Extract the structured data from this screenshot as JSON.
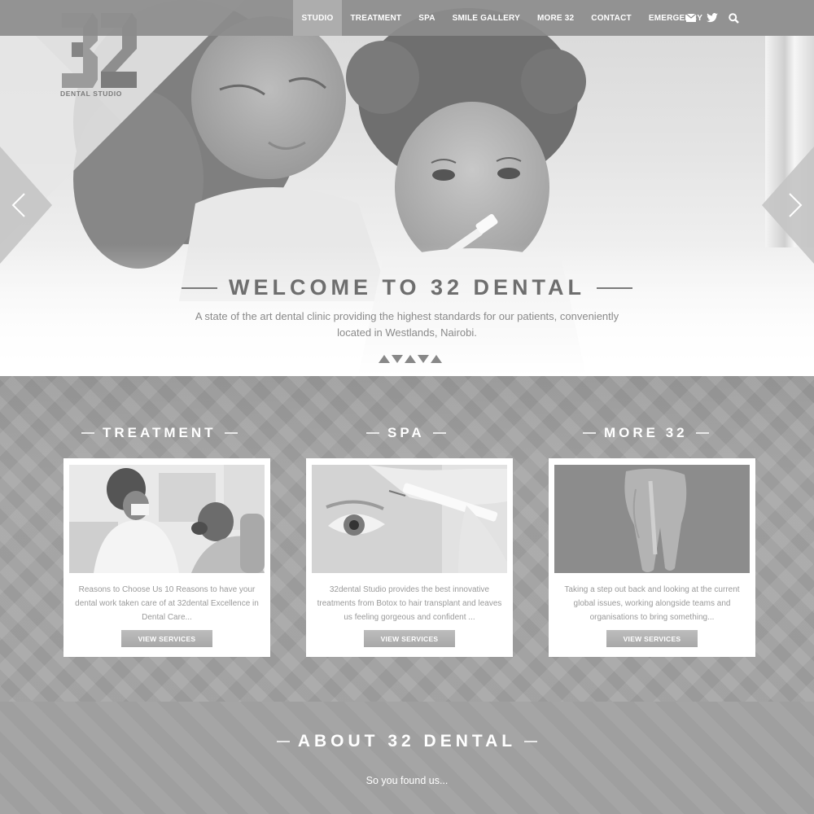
{
  "header": {
    "nav": [
      {
        "label": "STUDIO",
        "active": true
      },
      {
        "label": "TREATMENT",
        "active": false
      },
      {
        "label": "SPA",
        "active": false
      },
      {
        "label": "SMILE GALLERY",
        "active": false
      },
      {
        "label": "MORE 32",
        "active": false
      },
      {
        "label": "CONTACT",
        "active": false
      },
      {
        "label": "EMERGENCY",
        "active": false
      }
    ],
    "icons": [
      "envelope-icon",
      "twitter-icon",
      "search-icon"
    ]
  },
  "logo": {
    "mark": "32",
    "text": "DENTAL STUDIO"
  },
  "hero": {
    "title": "WELCOME TO 32 DENTAL",
    "subtitle": "A state of the art dental clinic providing the highest standards for our patients, conveniently located in Westlands, Nairobi.",
    "prev_icon": "chevron-left-icon",
    "next_icon": "chevron-right-icon"
  },
  "services": [
    {
      "title": "TREATMENT",
      "image": "dentist-with-patient",
      "text": "Reasons to Choose Us 10 Reasons to have your dental work taken care of at 32dental Excellence in Dental Care...",
      "button": "VIEW SERVICES"
    },
    {
      "title": "SPA",
      "image": "eye-botox-injection",
      "text": "32dental Studio provides the best innovative treatments from Botox to hair transplant and leaves us feeling gorgeous and confident ...",
      "button": "VIEW SERVICES"
    },
    {
      "title": "MORE 32",
      "image": "tooth-model",
      "text": "Taking a step out back and looking at the current global issues, working alongside teams and organisations to bring something...",
      "button": "VIEW SERVICES"
    }
  ],
  "about": {
    "title": "ABOUT 32 DENTAL",
    "subtitle": "So you found us..."
  },
  "colors": {
    "navbar": "#8c8c8c",
    "section_bg": "#a3a3a3",
    "card_bg": "#ffffff",
    "button": "#b0b0b0"
  }
}
